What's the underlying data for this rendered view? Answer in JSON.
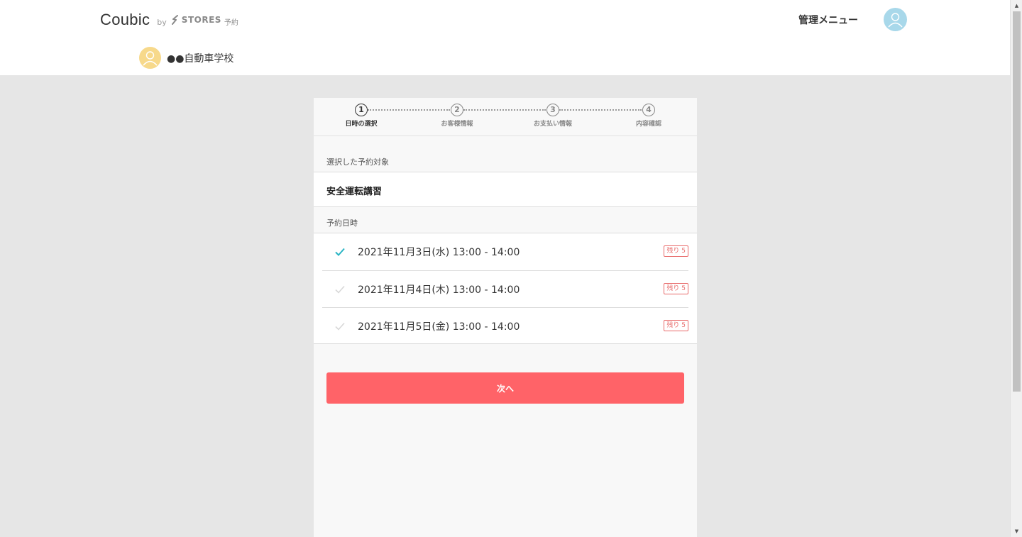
{
  "header": {
    "logo_main": "Coubic",
    "logo_by": "by",
    "logo_stores": "STORES",
    "logo_yoyaku": "予約",
    "admin_menu_label": "管理メニュー",
    "shop_name": "●●自動車学校"
  },
  "steps": [
    {
      "number": "1",
      "label": "日時の選択",
      "active": true
    },
    {
      "number": "2",
      "label": "お客様情報",
      "active": false
    },
    {
      "number": "3",
      "label": "お支払い情報",
      "active": false
    },
    {
      "number": "4",
      "label": "内容確認",
      "active": false
    }
  ],
  "booking": {
    "target_label": "選択した予約対象",
    "target_value": "安全運転講習",
    "datetime_label": "予約日時",
    "slots": [
      {
        "text": "2021年11月3日(水)  13:00 - 14:00",
        "badge": "残り 5",
        "selected": true
      },
      {
        "text": "2021年11月4日(木)  13:00 - 14:00",
        "badge": "残り 5",
        "selected": false
      },
      {
        "text": "2021年11月5日(金)  13:00 - 14:00",
        "badge": "残り 5",
        "selected": false
      }
    ],
    "next_label": "次へ"
  },
  "colors": {
    "accent": "#ff6368",
    "check_selected": "#2bb5c4",
    "badge": "#e86a6a"
  },
  "icons": {
    "stores_logo": "stores-mark-icon",
    "avatar": "user-avatar-icon",
    "check": "check-icon"
  }
}
